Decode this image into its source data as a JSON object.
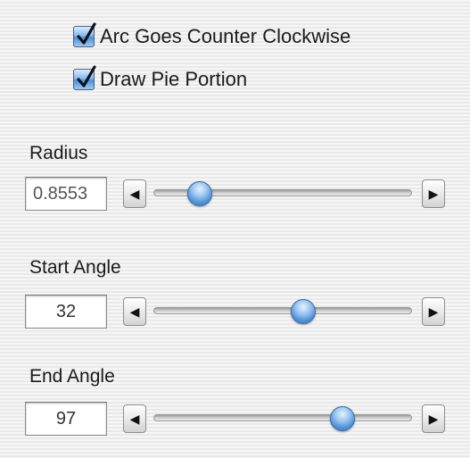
{
  "options": {
    "arc_ccw": {
      "label": "Arc Goes Counter Clockwise",
      "checked": true
    },
    "draw_pie": {
      "label": "Draw Pie Portion",
      "checked": true
    }
  },
  "radius": {
    "label": "Radius",
    "value_text": "0.8553",
    "slider_fraction": 0.18
  },
  "start_angle": {
    "label": "Start Angle",
    "value_text": "32",
    "slider_fraction": 0.58
  },
  "end_angle": {
    "label": "End Angle",
    "value_text": "97",
    "slider_fraction": 0.73
  },
  "icons": {
    "left": "left-arrow-icon",
    "right": "right-arrow-icon",
    "check": "checkmark-icon"
  },
  "colors": {
    "accent": "#4a90dd",
    "knob": "#4f8fd6"
  }
}
